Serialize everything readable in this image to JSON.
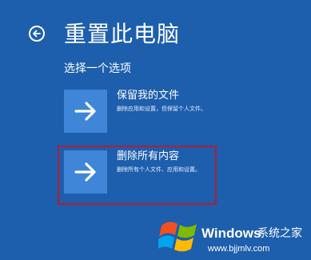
{
  "header": {
    "back_icon": "back-arrow-icon",
    "title": "重置此电脑",
    "subtitle": "选择一个选项"
  },
  "options": [
    {
      "title": "保留我的文件",
      "description": "删除应用和设置，但保留个人文件。",
      "icon": "arrow-right-icon",
      "highlighted": false
    },
    {
      "title": "删除所有内容",
      "description": "删除所有个人文件、应用和设置。",
      "icon": "arrow-right-icon",
      "highlighted": true
    }
  ],
  "watermark": {
    "brand": "Windows",
    "cn_name": "系统之家",
    "url": "www.bjjmlv.com",
    "logo_icon": "windows-logo-icon"
  },
  "colors": {
    "background": "#1d5ead",
    "tile": "#3f86d9",
    "highlight_border": "#b21e34"
  }
}
